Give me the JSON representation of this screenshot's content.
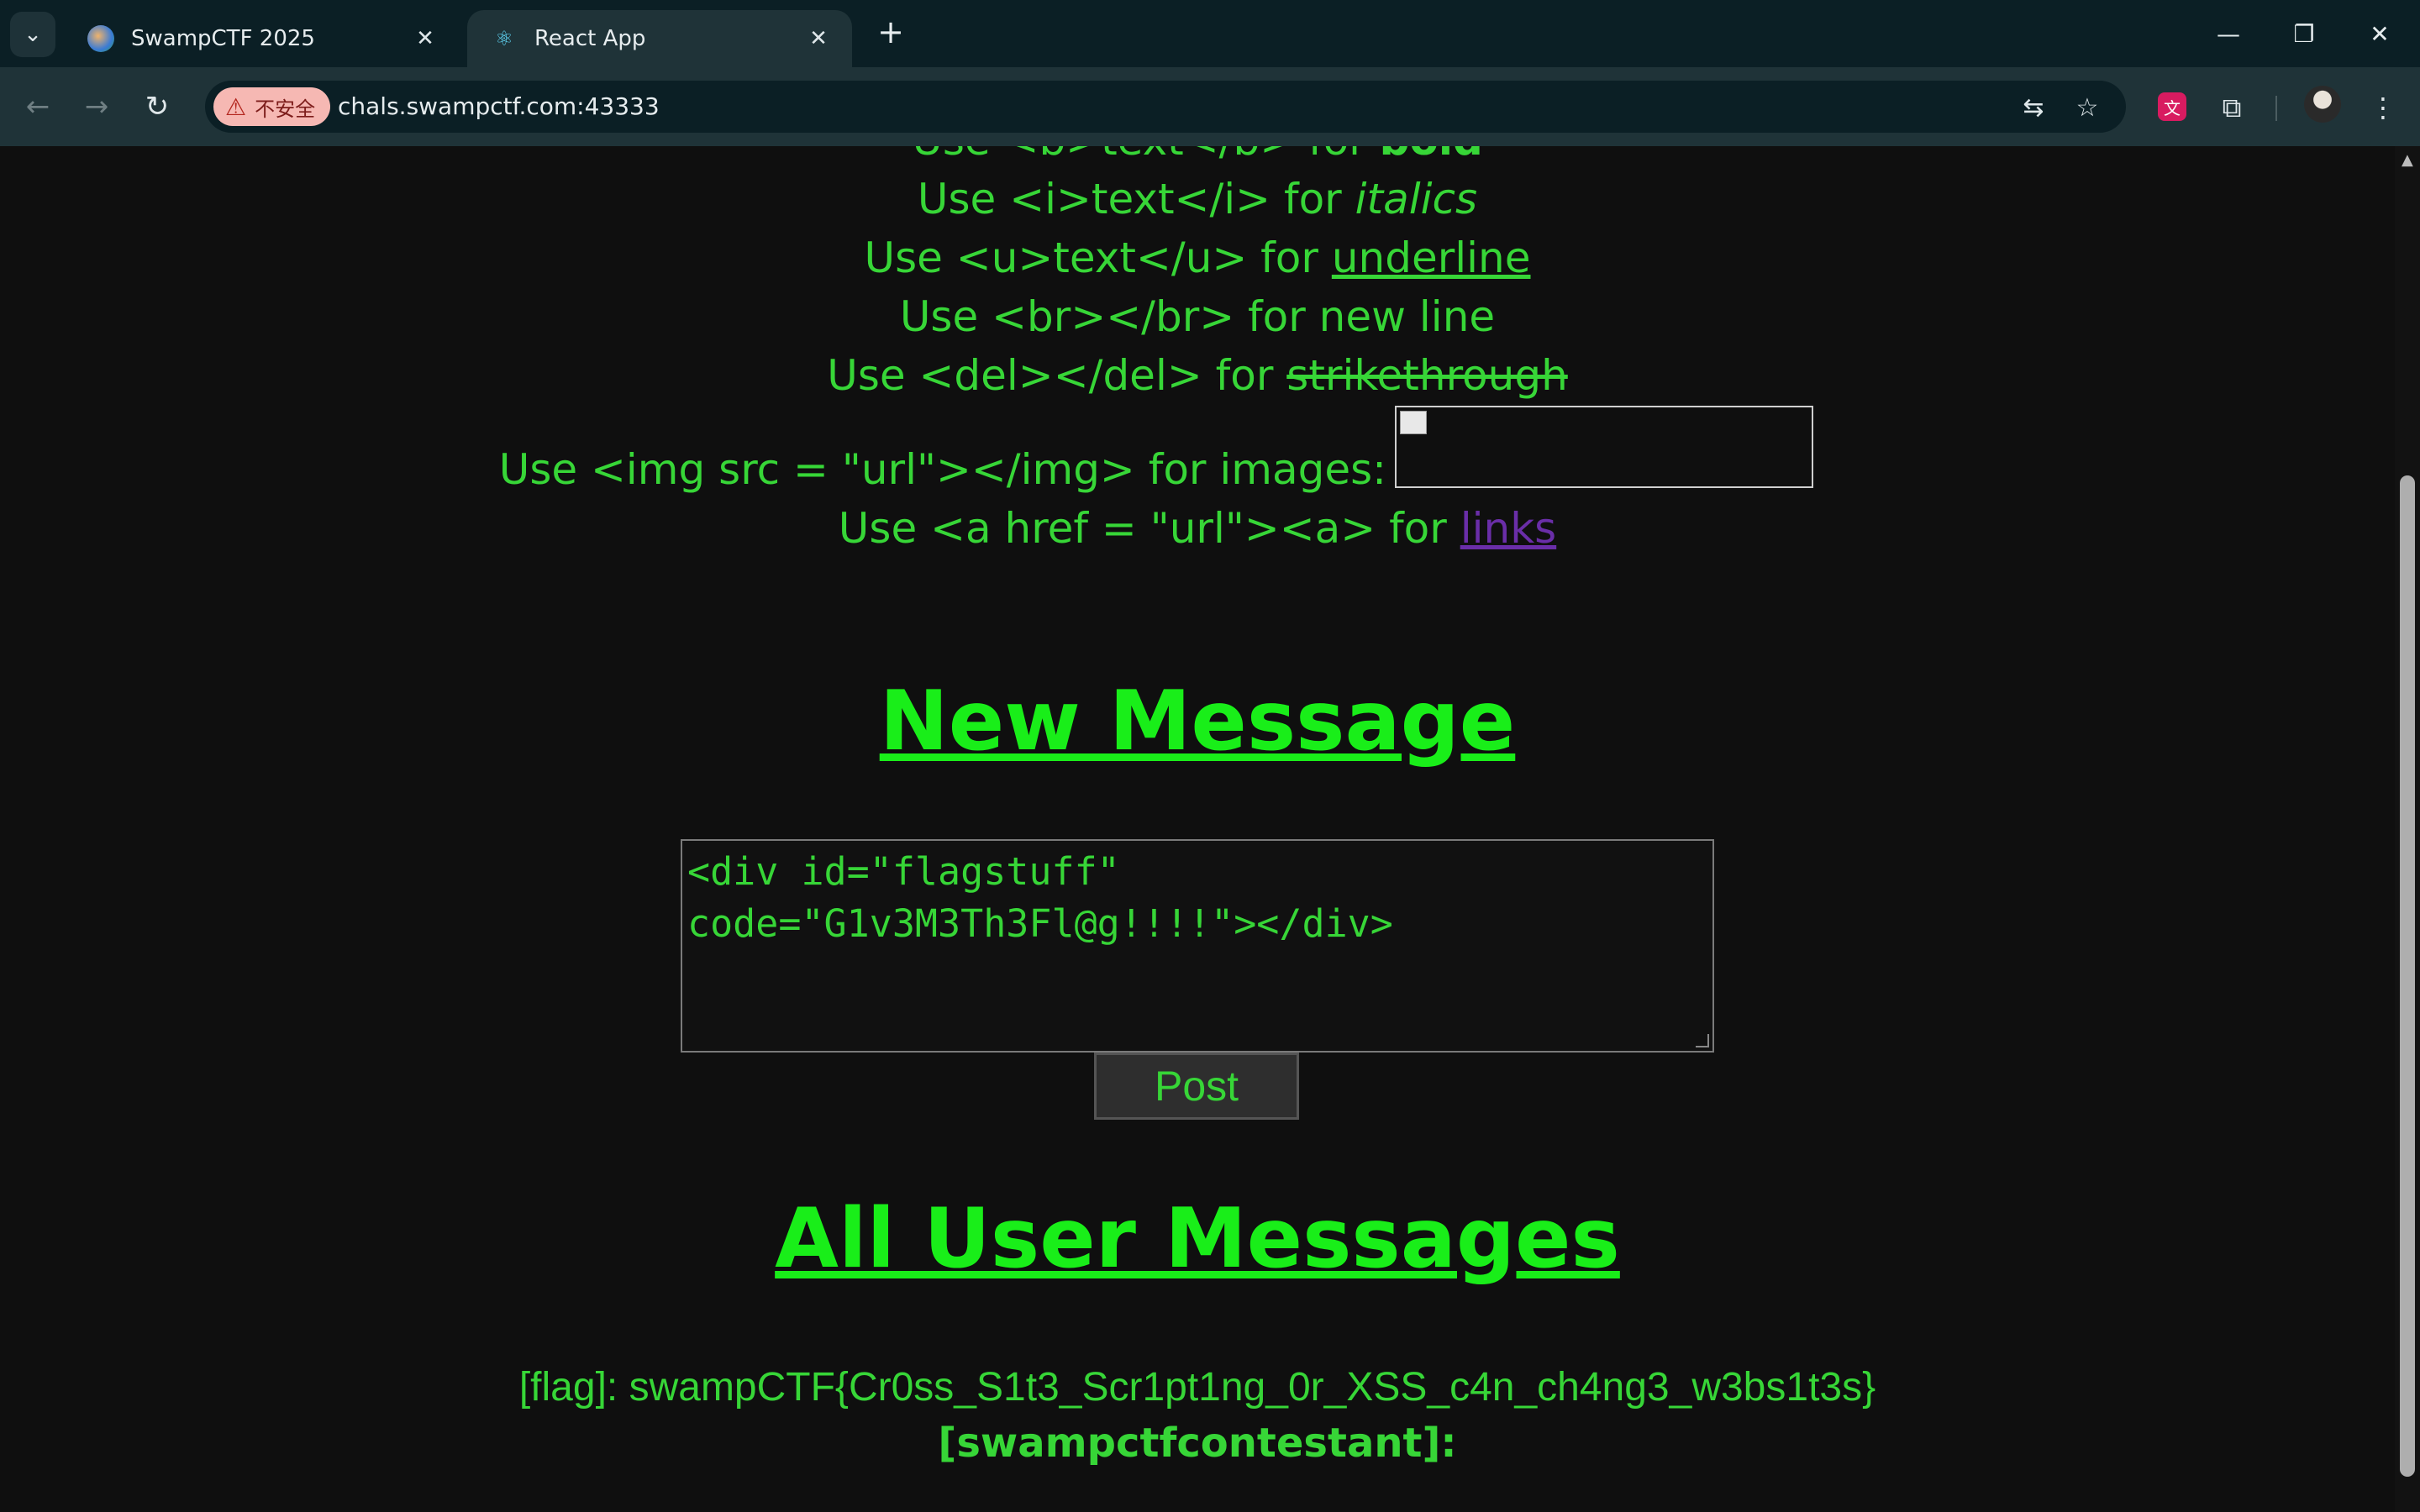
{
  "browser": {
    "tabs": [
      {
        "title": "SwampCTF 2025",
        "active": false
      },
      {
        "title": "React App",
        "active": true
      }
    ],
    "security_label": "不安全",
    "url": "chals.swampctf.com:43333"
  },
  "help": {
    "bold_line": {
      "prefix": "Use <b>text</b> for ",
      "demo": "bold"
    },
    "italic_line": {
      "prefix": "Use <i>text</i> for ",
      "demo": "italics"
    },
    "underline_line": {
      "prefix": "Use <u>text</u> for ",
      "demo": "underline"
    },
    "br_line": "Use <br></br> for new line",
    "del_line": {
      "prefix": "Use <del></del> for ",
      "demo": "strikethrough"
    },
    "img_line": "Use <img src = \"url\"></img> for images:",
    "link_line": {
      "prefix": "Use <a href = \"url\"><a> for ",
      "demo": "links"
    }
  },
  "new_message": {
    "title": "New Message",
    "textarea_value": "<div id=\"flagstuff\"\ncode=\"G1v3M3Th3Fl@g!!!!\"></div>",
    "post_label": "Post"
  },
  "all_messages": {
    "title": "All User Messages",
    "messages": [
      {
        "author": "[flag]:",
        "text": " swampCTF{Cr0ss_S1t3_Scr1pt1ng_0r_XSS_c4n_ch4ng3_w3bs1t3s}"
      },
      {
        "author": "[swampctfcontestant]:",
        "text": ""
      }
    ]
  },
  "colors": {
    "text_green": "#37d637",
    "heading_green": "#19ee19",
    "link_purple": "#6a2ea8",
    "background": "#0f0f0f"
  }
}
